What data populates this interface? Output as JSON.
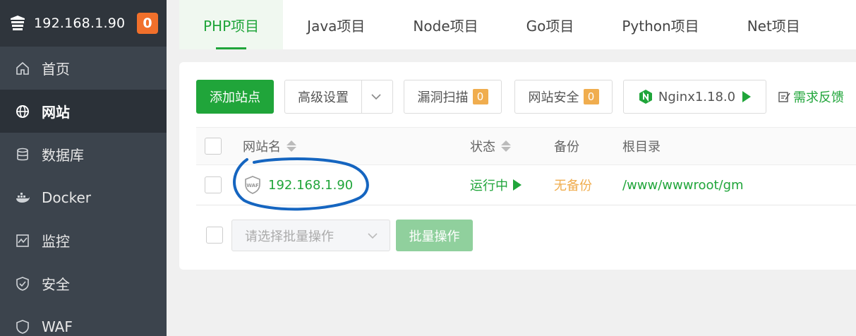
{
  "sidebar": {
    "host": "192.168.1.90",
    "badge": "0",
    "items": [
      {
        "label": "首页",
        "icon": "home-icon"
      },
      {
        "label": "网站",
        "icon": "globe-icon",
        "active": true
      },
      {
        "label": "数据库",
        "icon": "database-icon"
      },
      {
        "label": "Docker",
        "icon": "docker-icon"
      },
      {
        "label": "监控",
        "icon": "monitor-icon"
      },
      {
        "label": "安全",
        "icon": "shield-icon"
      },
      {
        "label": "WAF",
        "icon": "waf-icon"
      }
    ]
  },
  "tabs": [
    {
      "label": "PHP项目",
      "active": true
    },
    {
      "label": "Java项目"
    },
    {
      "label": "Node项目"
    },
    {
      "label": "Go项目"
    },
    {
      "label": "Python项目"
    },
    {
      "label": "Net项目"
    }
  ],
  "toolbar": {
    "add_site": "添加站点",
    "advanced": "高级设置",
    "vuln_scan": "漏洞扫描",
    "vuln_count": "0",
    "site_security": "网站安全",
    "security_count": "0",
    "nginx": "Nginx1.18.0",
    "feedback": "需求反馈"
  },
  "table": {
    "headers": {
      "name": "网站名",
      "status": "状态",
      "backup": "备份",
      "root": "根目录"
    },
    "rows": [
      {
        "name": "192.168.1.90",
        "status": "运行中",
        "backup": "无备份",
        "root": "/www/wwwroot/gm"
      }
    ]
  },
  "bulk": {
    "placeholder": "请选择批量操作",
    "button": "批量操作"
  },
  "colors": {
    "accent": "#20a53a",
    "warning": "#f0ad4e",
    "badge": "#f1702b",
    "sidebar": "#3c444d",
    "annotation": "#1565c0"
  }
}
